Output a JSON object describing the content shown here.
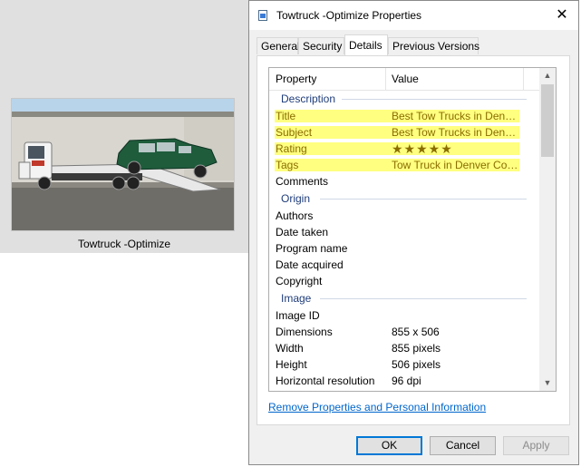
{
  "thumbnail": {
    "caption": "Towtruck -Optimize"
  },
  "dialog": {
    "title": "Towtruck -Optimize Properties",
    "close_glyph": "✕",
    "tabs": [
      {
        "label": "General"
      },
      {
        "label": "Security"
      },
      {
        "label": "Details",
        "active": true
      },
      {
        "label": "Previous Versions"
      }
    ],
    "columns": {
      "property": "Property",
      "value": "Value"
    },
    "groups": {
      "description": {
        "label": "Description",
        "rows": [
          {
            "name": "Title",
            "value": "Best Tow Trucks in Denver..."
          },
          {
            "name": "Subject",
            "value": "Best Tow Trucks in Denver..."
          },
          {
            "name": "Rating",
            "value": "★★★★★"
          },
          {
            "name": "Tags",
            "value": "Tow Truck in Denver Color..."
          },
          {
            "name": "Comments",
            "value": ""
          }
        ]
      },
      "origin": {
        "label": "Origin",
        "rows": [
          {
            "name": "Authors",
            "value": ""
          },
          {
            "name": "Date taken",
            "value": ""
          },
          {
            "name": "Program name",
            "value": ""
          },
          {
            "name": "Date acquired",
            "value": ""
          },
          {
            "name": "Copyright",
            "value": ""
          }
        ]
      },
      "image": {
        "label": "Image",
        "rows": [
          {
            "name": "Image ID",
            "value": ""
          },
          {
            "name": "Dimensions",
            "value": "855 x 506"
          },
          {
            "name": "Width",
            "value": "855 pixels"
          },
          {
            "name": "Height",
            "value": "506 pixels"
          },
          {
            "name": "Horizontal resolution",
            "value": "96 dpi"
          }
        ]
      }
    },
    "remove_link": "Remove Properties and Personal Information",
    "buttons": {
      "ok": "OK",
      "cancel": "Cancel",
      "apply": "Apply"
    },
    "highlight_color": "#ffff80"
  }
}
